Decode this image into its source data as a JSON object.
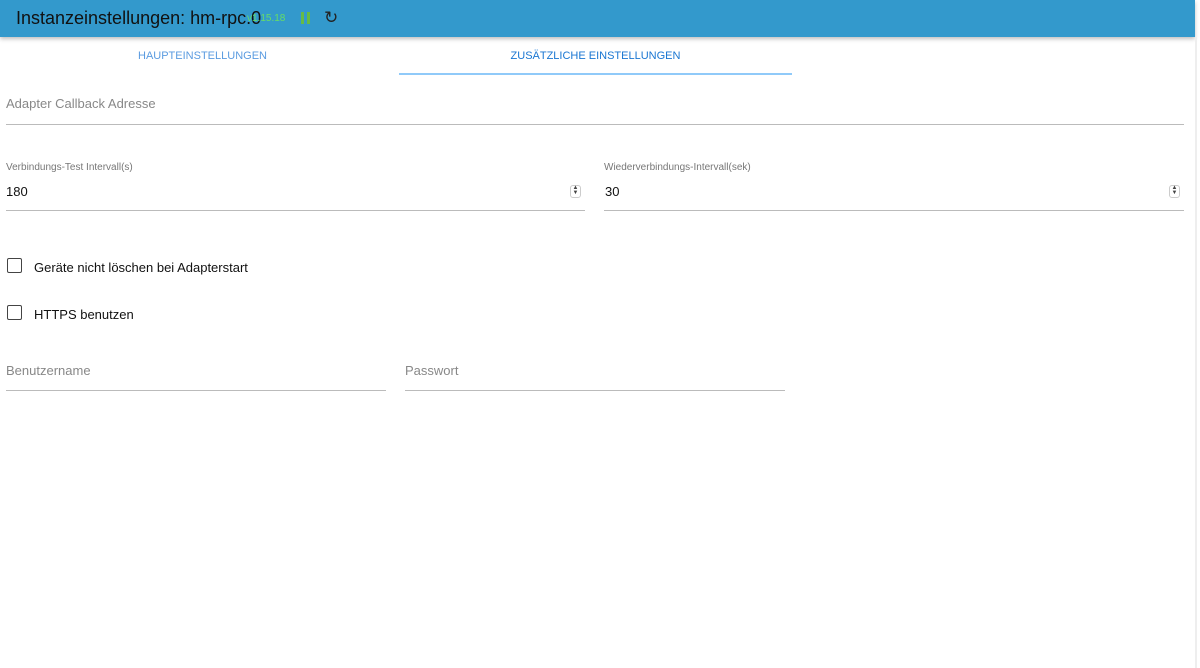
{
  "header": {
    "title": "Instanzeinstellungen: hm-rpc.0",
    "version": "v1.15.18"
  },
  "tabs": [
    {
      "label": "HAUPTEINSTELLUNGEN"
    },
    {
      "label": "ZUSÄTZLICHE EINSTELLUNGEN",
      "active": true
    }
  ],
  "fields": {
    "callback": {
      "placeholder": "Adapter Callback Adresse"
    },
    "check_interval": {
      "label": "Verbindungs-Test Intervall(s)",
      "value": "180"
    },
    "reconnect_interval": {
      "label": "Wiederverbindungs-Intervall(sek)",
      "value": "30"
    },
    "username": {
      "placeholder": "Benutzername"
    },
    "password": {
      "placeholder": "Passwort"
    }
  },
  "checkboxes": [
    {
      "label": "Geräte nicht löschen bei Adapterstart",
      "checked": false
    },
    {
      "label": "HTTPS benutzen",
      "checked": false
    }
  ],
  "colors": {
    "header": "#3399cc",
    "accent": "#1976d2",
    "version": "#66dd66"
  }
}
